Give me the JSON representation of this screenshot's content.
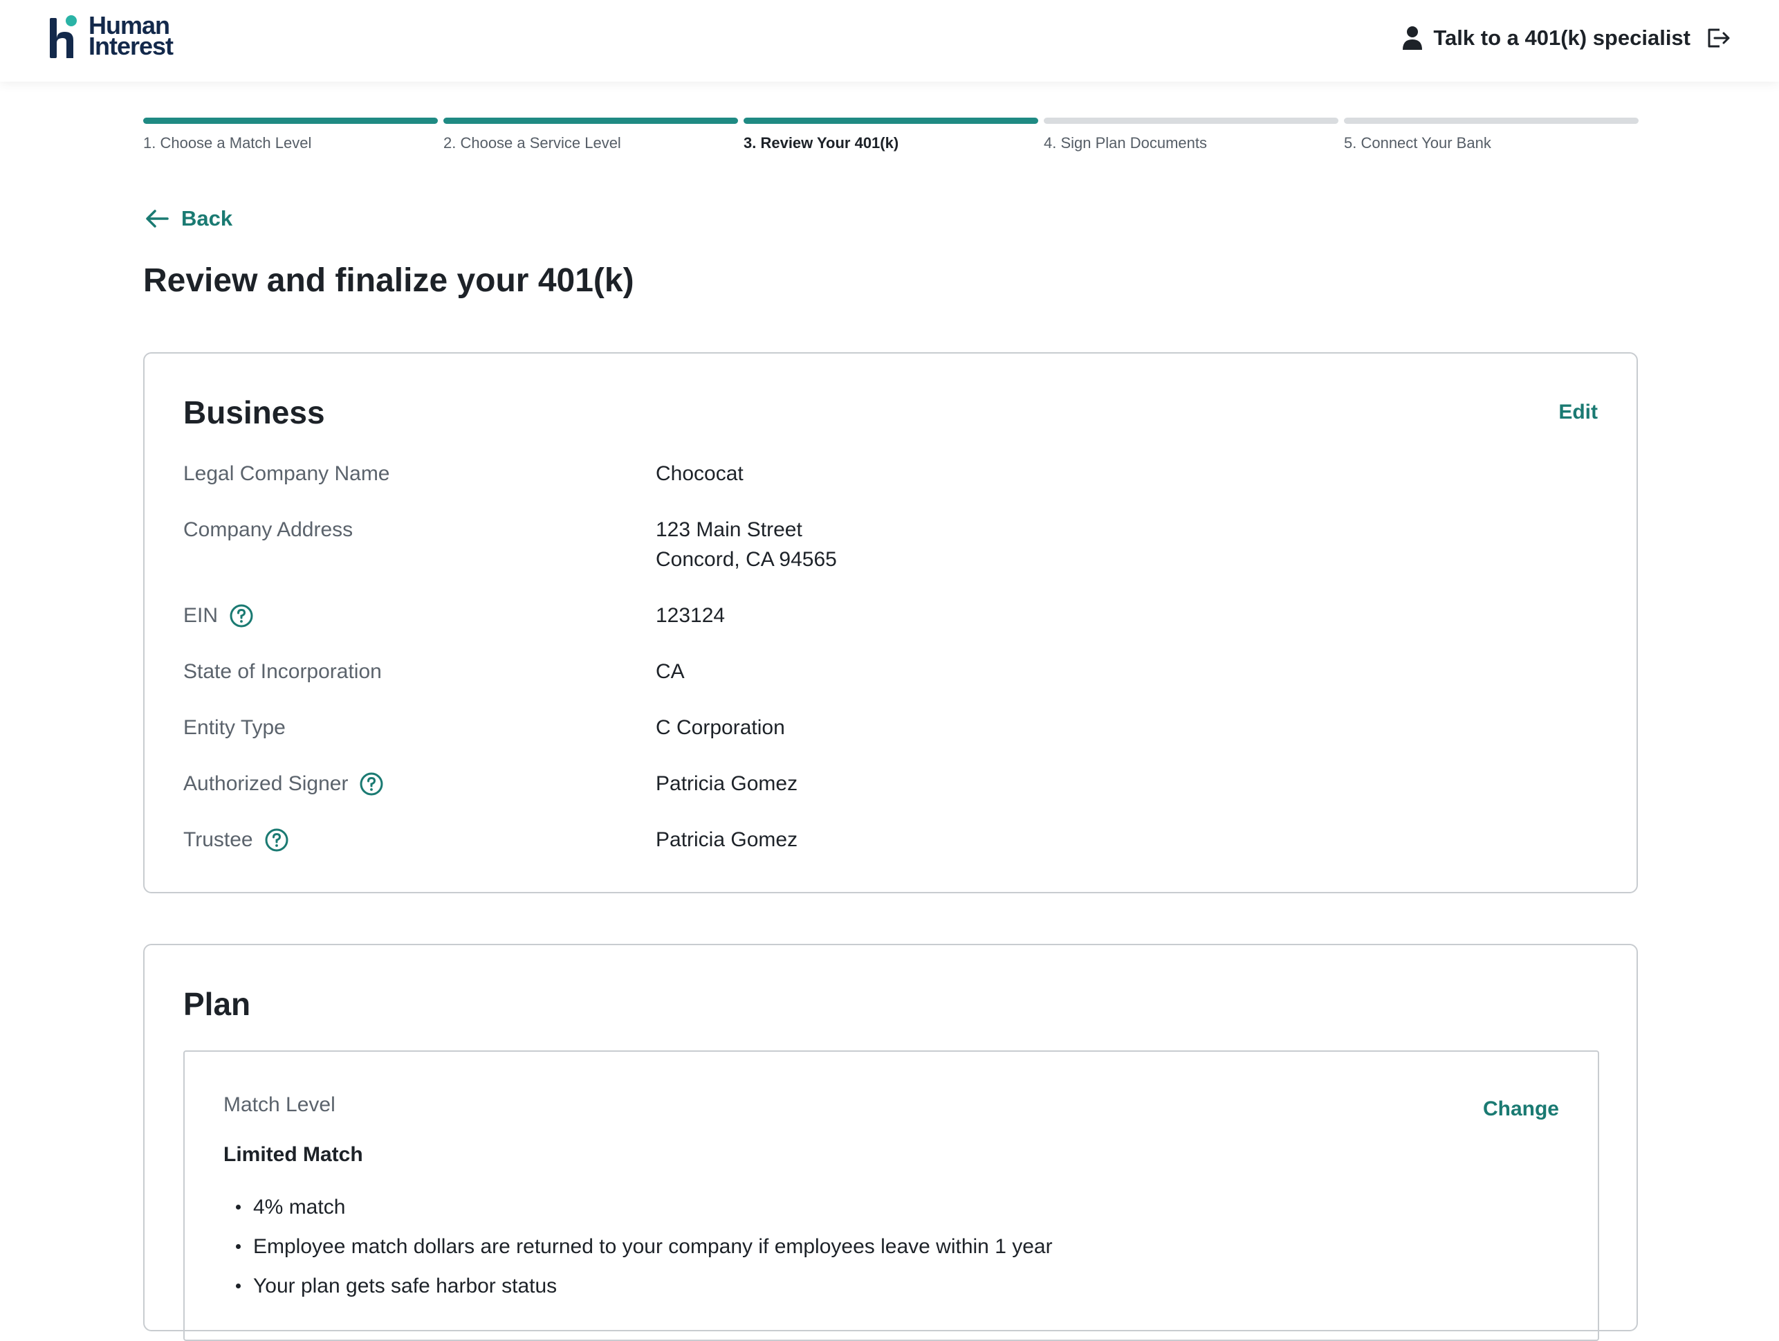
{
  "header": {
    "logo_line1": "Human",
    "logo_line2": "Interest",
    "specialist_label": "Talk to a 401(k) specialist",
    "brand_color": "#13294b",
    "accent_color": "#1f8a83"
  },
  "stepper": {
    "steps": [
      {
        "label": "1. Choose a Match Level",
        "state": "done"
      },
      {
        "label": "2. Choose a Service Level",
        "state": "done"
      },
      {
        "label": "3. Review Your 401(k)",
        "state": "active"
      },
      {
        "label": "4. Sign Plan Documents",
        "state": "upcoming"
      },
      {
        "label": "5. Connect Your Bank",
        "state": "upcoming"
      }
    ]
  },
  "back_label": "Back",
  "page_title": "Review and finalize your 401(k)",
  "business": {
    "title": "Business",
    "edit_label": "Edit",
    "rows": [
      {
        "label": "Legal Company Name",
        "value": "Chococat",
        "value2": ""
      },
      {
        "label": "Company Address",
        "value": "123 Main Street",
        "value2": "Concord, CA 94565"
      },
      {
        "label": "EIN",
        "value": "123124",
        "value2": ""
      },
      {
        "label": "State of Incorporation",
        "value": "CA",
        "value2": ""
      },
      {
        "label": "Entity Type",
        "value": "C Corporation",
        "value2": ""
      },
      {
        "label": "Authorized Signer",
        "value": "Patricia Gomez",
        "value2": ""
      },
      {
        "label": "Trustee",
        "value": "Patricia Gomez",
        "value2": ""
      }
    ]
  },
  "plan": {
    "title": "Plan",
    "match_level_label": "Match Level",
    "change_label": "Change",
    "match_title": "Limited Match",
    "bullets": [
      "4% match",
      "Employee match dollars are returned to your company if employees leave within 1 year",
      "Your plan gets safe harbor status"
    ]
  }
}
